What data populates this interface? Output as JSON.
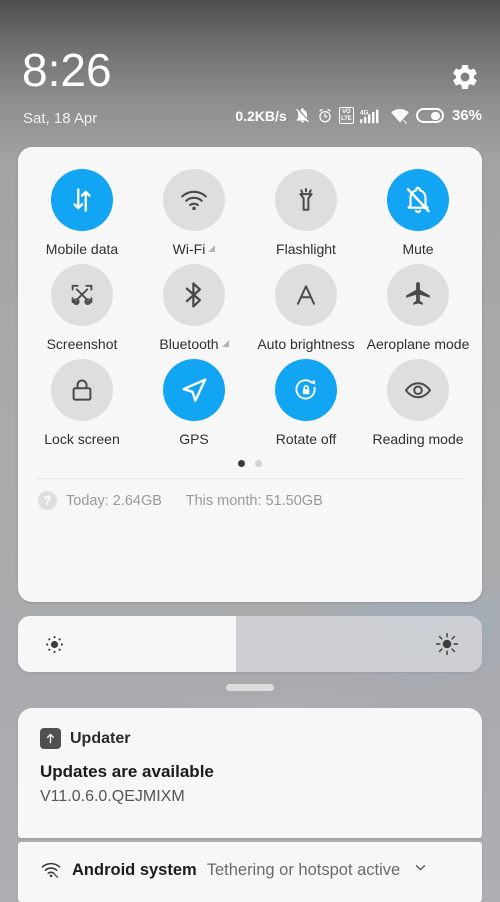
{
  "statusbar": {
    "clock": "8:26",
    "date": "Sat, 18 Apr",
    "network_speed": "0.2KB/s",
    "battery_percent": "36%",
    "volte_top": "VO",
    "volte_bottom": "LTE",
    "signal_gen": "4G",
    "icons": [
      "mute-bell-icon",
      "alarm-clock-icon",
      "volte-icon",
      "signal-4g-icon",
      "wifi-icon",
      "battery-icon"
    ],
    "settings_icon": "gear-icon"
  },
  "quick_settings": {
    "accent_color": "#12a5f4",
    "inactive_color": "#dedede",
    "tiles": [
      {
        "label": "Mobile data",
        "icon": "mobile-data-icon",
        "active": true,
        "has_arrow": false
      },
      {
        "label": "Wi-Fi",
        "icon": "wifi-icon",
        "active": false,
        "has_arrow": true
      },
      {
        "label": "Flashlight",
        "icon": "flashlight-icon",
        "active": false,
        "has_arrow": false
      },
      {
        "label": "Mute",
        "icon": "bell-off-icon",
        "active": true,
        "has_arrow": false
      },
      {
        "label": "Screenshot",
        "icon": "scissors-icon",
        "active": false,
        "has_arrow": false
      },
      {
        "label": "Bluetooth",
        "icon": "bluetooth-icon",
        "active": false,
        "has_arrow": true
      },
      {
        "label": "Auto brightness",
        "icon": "auto-brightness-icon",
        "active": false,
        "has_arrow": false
      },
      {
        "label": "Aeroplane mode",
        "icon": "airplane-icon",
        "active": false,
        "has_arrow": false
      },
      {
        "label": "Lock screen",
        "icon": "lock-icon",
        "active": false,
        "has_arrow": false
      },
      {
        "label": "GPS",
        "icon": "navigation-arrow-icon",
        "active": true,
        "has_arrow": false
      },
      {
        "label": "Rotate off",
        "icon": "rotate-lock-icon",
        "active": true,
        "has_arrow": false
      },
      {
        "label": "Reading mode",
        "icon": "eye-icon",
        "active": false,
        "has_arrow": false
      }
    ],
    "pages": {
      "count": 2,
      "current": 1
    },
    "data_usage": {
      "help_icon": "question-mark-icon",
      "today": "Today: 2.64GB",
      "month": "This month: 51.50GB"
    }
  },
  "brightness": {
    "level_percent": 47,
    "low_icon": "brightness-low-icon",
    "high_icon": "brightness-high-icon"
  },
  "notifications": [
    {
      "app": "Updater",
      "app_icon": "update-arrow-icon",
      "title": "Updates are available",
      "body": "V11.0.6.0.QEJMIXM"
    },
    {
      "app": "Android system",
      "app_icon": "hotspot-wifi-icon",
      "subtitle": "Tethering or hotspot active",
      "expand_icon": "chevron-down-icon"
    }
  ]
}
